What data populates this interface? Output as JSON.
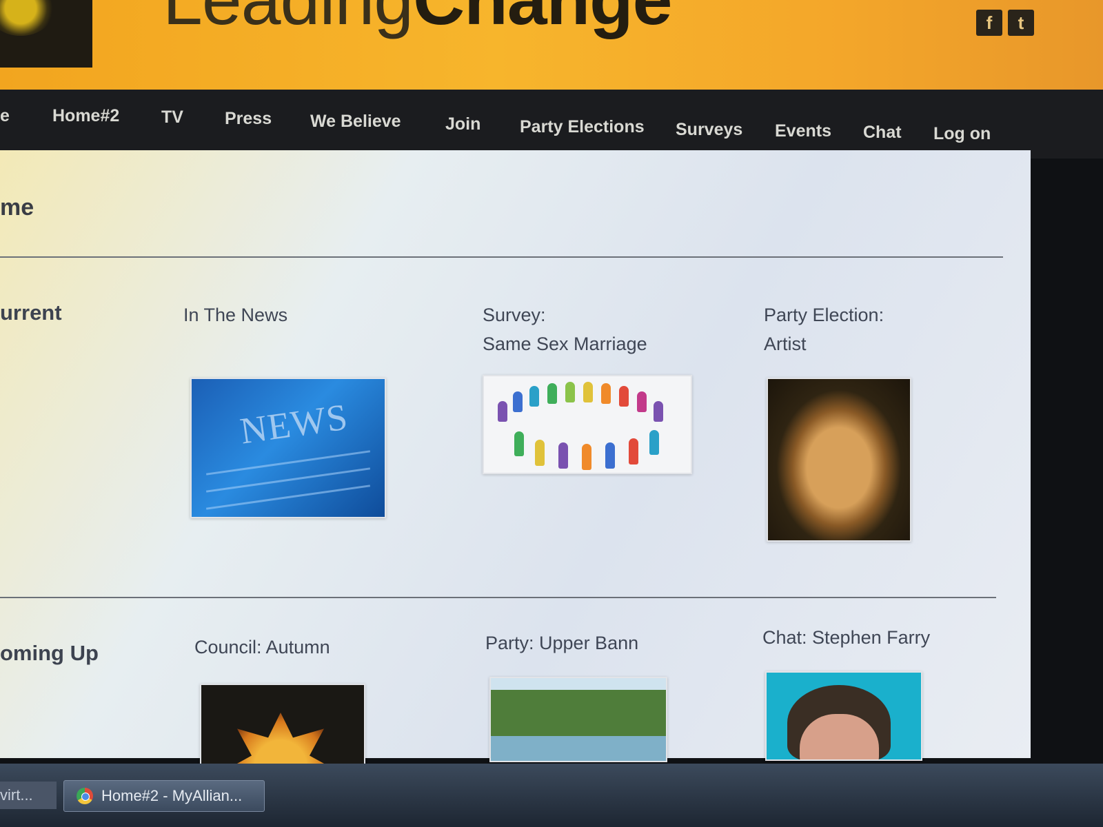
{
  "header": {
    "wordmark_light": "Leading",
    "wordmark_bold": "Change",
    "social": [
      {
        "label": "f",
        "icon": "facebook-icon"
      },
      {
        "label": "t",
        "icon": "twitter-icon"
      }
    ]
  },
  "nav": {
    "items": [
      "e",
      "Home#2",
      "TV",
      "Press",
      "We Believe",
      "Join",
      "Party Elections",
      "Surveys",
      "Events",
      "Chat",
      "Log on"
    ]
  },
  "page": {
    "title": "me"
  },
  "current": {
    "label": "urrent",
    "cards": [
      {
        "title_line1": "In The News",
        "title_line2": "",
        "image": "news-image",
        "image_text": "NEWS"
      },
      {
        "title_line1": "Survey:",
        "title_line2": "Same Sex Marriage",
        "image": "people-circle-image"
      },
      {
        "title_line1": "Party Election:",
        "title_line2": "Artist",
        "image": "mona-lisa-portrait"
      }
    ]
  },
  "coming_up": {
    "label": "oming Up",
    "cards": [
      {
        "title": "Council: Autumn",
        "image": "autumn-leaf-image"
      },
      {
        "title": "Party: Upper Bann",
        "image": "river-landscape-image"
      },
      {
        "title": "Chat: Stephen Farry",
        "image": "person-photo"
      }
    ]
  },
  "taskbar": {
    "prev_label": "virt...",
    "active_task": "Home#2 - MyAllian...",
    "active_icon": "chrome-icon"
  },
  "colors": {
    "banner": "#f7b52c",
    "nav_bg": "#1b1c1f",
    "nav_text": "#d9d9d3",
    "heading_text": "#3f4655"
  }
}
